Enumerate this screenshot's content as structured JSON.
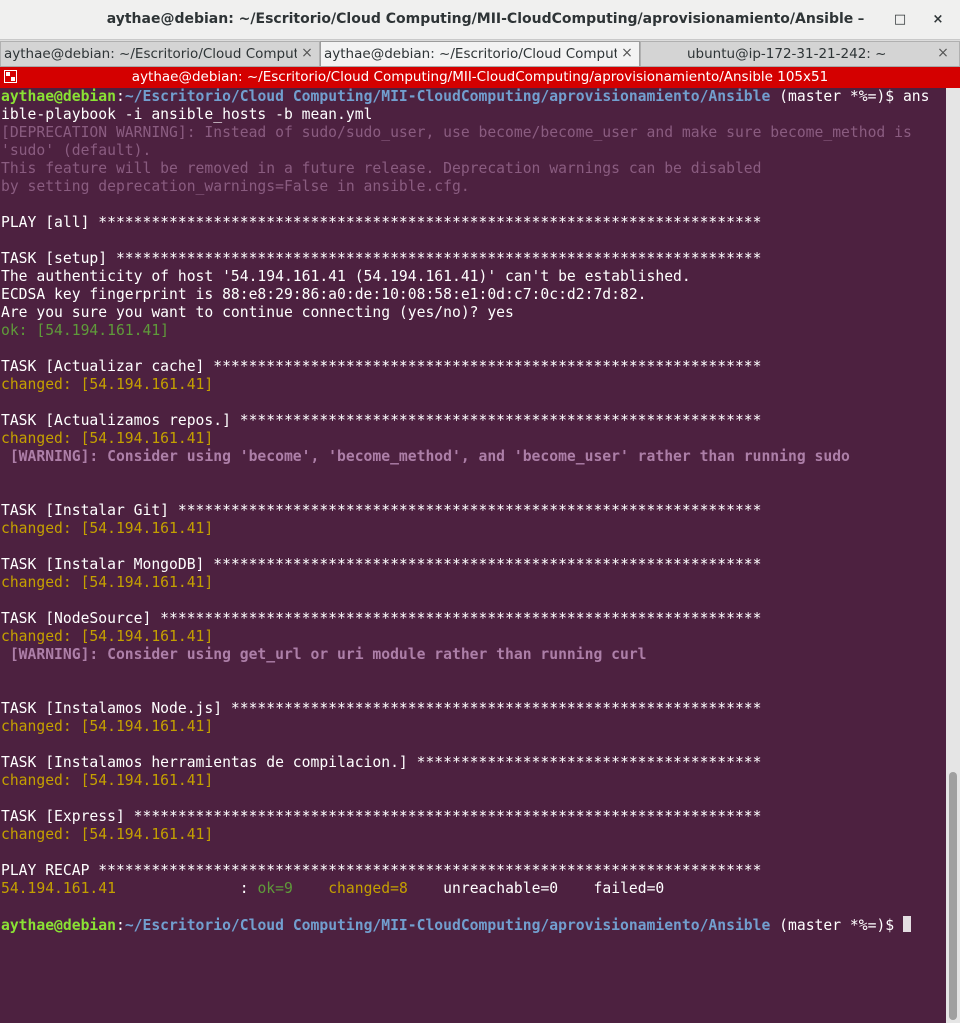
{
  "window": {
    "title": "aythae@debian: ~/Escritorio/Cloud Computing/MII-CloudComputing/aprovisionamiento/Ansible",
    "minimize_glyph": "–",
    "maximize_glyph": "□",
    "close_glyph": "×"
  },
  "tabs": [
    {
      "label": "aythae@debian: ~/Escritorio/Cloud Computing/MII-CloudComputing/aprovisionamiento/Ansible",
      "active": false
    },
    {
      "label": "aythae@debian: ~/Escritorio/Cloud Computing/MII-CloudComputing/aprovisionamiento/Ansible",
      "active": true
    },
    {
      "label": "ubuntu@ip-172-31-21-242: ~",
      "active": false
    }
  ],
  "tab_close_glyph": "×",
  "terminal_header": {
    "title": "aythae@debian: ~/Escritorio/Cloud Computing/MII-CloudComputing/aprovisionamiento/Ansible 105x51"
  },
  "terminal": {
    "prompt_user": "aythae@debian",
    "prompt_sep": ":",
    "prompt_path": "~/Escritorio/Cloud Computing/MII-CloudComputing/aprovisionamiento/Ansible",
    "prompt_git": " (master *%=)$ ",
    "command_part1": "ans",
    "command_part2": "ible-playbook -i ansible_hosts -b mean.yml",
    "deprecation": [
      "[DEPRECATION WARNING]: Instead of sudo/sudo_user, use become/become_user and make sure become_method is",
      "'sudo' (default).",
      "This feature will be removed in a future release. Deprecation warnings can be disabled",
      "by setting deprecation_warnings=False in ansible.cfg."
    ],
    "play_line": "PLAY [all] ***************************************************************************",
    "setup_task": "TASK [setup] *************************************************************************",
    "auth_lines": [
      "The authenticity of host '54.194.161.41 (54.194.161.41)' can't be established.",
      "ECDSA key fingerprint is 88:e8:29:86:a0:de:10:08:58:e1:0d:c7:0c:d2:7d:82.",
      "Are you sure you want to continue connecting (yes/no)? yes"
    ],
    "ok_line": "ok: [54.194.161.41]",
    "tasks": [
      {
        "task": "TASK [Actualizar cache] **************************************************************",
        "result": "changed: [54.194.161.41]",
        "warning": ""
      },
      {
        "task": "TASK [Actualizamos repos.] ***********************************************************",
        "result": "changed: [54.194.161.41]",
        "warning": " [WARNING]: Consider using 'become', 'become_method', and 'become_user' rather than running sudo"
      },
      {
        "task": "TASK [Instalar Git] ******************************************************************",
        "result": "changed: [54.194.161.41]",
        "warning": ""
      },
      {
        "task": "TASK [Instalar MongoDB] **************************************************************",
        "result": "changed: [54.194.161.41]",
        "warning": ""
      },
      {
        "task": "TASK [NodeSource] ********************************************************************",
        "result": "changed: [54.194.161.41]",
        "warning": " [WARNING]: Consider using get_url or uri module rather than running curl"
      },
      {
        "task": "TASK [Instalamos Node.js] ************************************************************",
        "result": "changed: [54.194.161.41]",
        "warning": ""
      },
      {
        "task": "TASK [Instalamos herramientas de compilacion.] ***************************************",
        "result": "changed: [54.194.161.41]",
        "warning": ""
      },
      {
        "task": "TASK [Express] ***********************************************************************",
        "result": "changed: [54.194.161.41]",
        "warning": ""
      }
    ],
    "recap_line": "PLAY RECAP ***************************************************************************",
    "recap": {
      "host": "54.194.161.41",
      "sep": "              : ",
      "ok": "ok=9",
      "changed": "changed=8",
      "unreachable": "unreachable=0",
      "failed": "failed=0"
    }
  },
  "colors": {
    "terminal_bg": "#4d2140",
    "header_red": "#d40000",
    "prompt_user": "#8ae234",
    "prompt_path": "#729fcf",
    "ok_green": "#5f9a3a",
    "changed_yellow": "#c4a000",
    "warning_purple": "#ad7fa8"
  }
}
